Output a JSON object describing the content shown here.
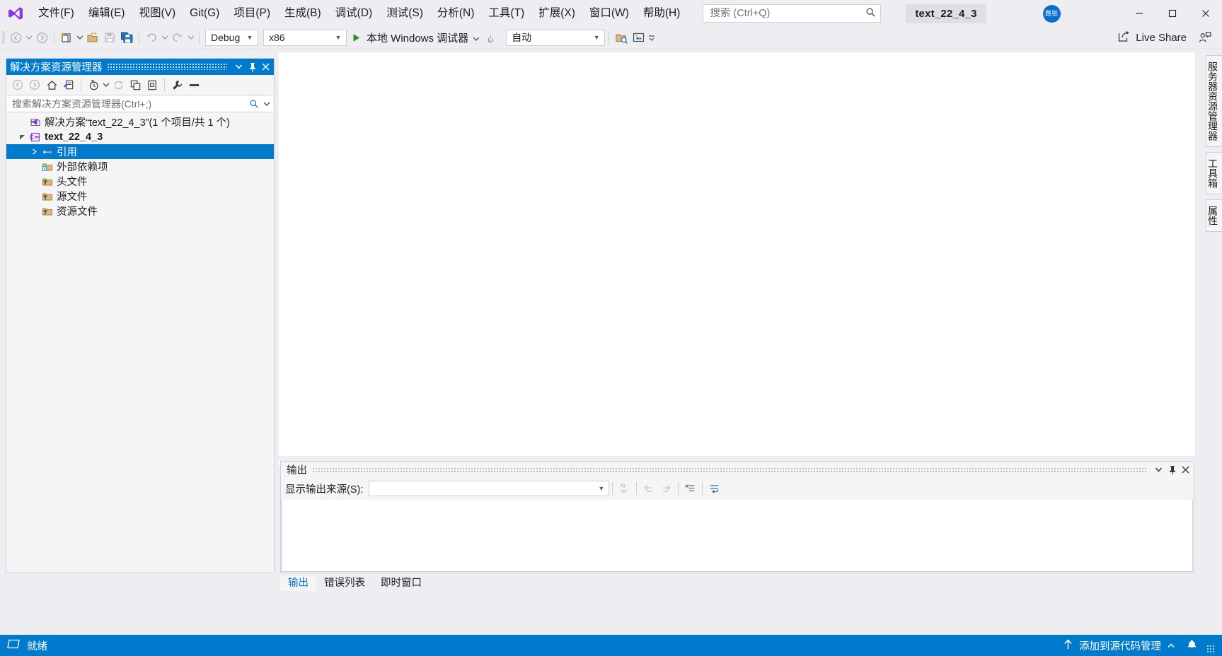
{
  "app": {
    "logo_icon": "visual-studio-logo",
    "document_title": "text_22_4_3",
    "account_initials": "路张"
  },
  "menu": {
    "items": [
      {
        "label": "文件(F)"
      },
      {
        "label": "编辑(E)"
      },
      {
        "label": "视图(V)"
      },
      {
        "label": "Git(G)"
      },
      {
        "label": "项目(P)"
      },
      {
        "label": "生成(B)"
      },
      {
        "label": "调试(D)"
      },
      {
        "label": "测试(S)"
      },
      {
        "label": "分析(N)"
      },
      {
        "label": "工具(T)"
      },
      {
        "label": "扩展(X)"
      },
      {
        "label": "窗口(W)"
      },
      {
        "label": "帮助(H)"
      }
    ]
  },
  "search": {
    "placeholder": "搜索 (Ctrl+Q)",
    "value": "",
    "icon": "search-icon"
  },
  "window_controls": {
    "minimize": "minimize-icon",
    "maximize": "maximize-icon",
    "close": "close-icon"
  },
  "toolbar": {
    "navigate_back": "navigate-back-icon",
    "navigate_forward": "navigate-forward-icon",
    "new_item": "new-item-icon",
    "open_file": "open-file-icon",
    "save": "save-icon",
    "save_all": "save-all-icon",
    "undo": "undo-icon",
    "redo": "redo-icon",
    "config": {
      "value": "Debug"
    },
    "platform": {
      "value": "x86"
    },
    "run_label": "本地 Windows 调试器",
    "hot_reload": "hot-reload-icon",
    "auto": {
      "value": "自动"
    },
    "select_window": "select-window-icon",
    "preview": "preview-icon",
    "live_share_label": "Live Share",
    "feedback": "feedback-icon"
  },
  "solution_explorer": {
    "title": "解决方案资源管理器",
    "header_color": "#007ACC",
    "window_menu_icon": "chevron-down-icon",
    "pin_icon": "pin-icon",
    "close_icon": "close-icon",
    "toolbar": {
      "back": "navigate-back-icon",
      "forward": "navigate-forward-icon",
      "home": "home-icon",
      "pending_changes": "pending-changes-icon",
      "history": "history-icon",
      "sync": "sync-icon",
      "collapse_all": "collapse-all-icon",
      "show_all_files": "show-all-files-icon",
      "properties": "properties-wrench-icon",
      "preview_selected": "preview-selected-icon"
    },
    "search": {
      "placeholder": "搜索解决方案资源管理器(Ctrl+;)",
      "value": "",
      "icon": "search-icon",
      "filter_icon": "chevron-down-icon"
    },
    "tree": [
      {
        "label": "解决方案“text_22_4_3”(1 个项目/共 1 个)",
        "icon": "solution-icon",
        "indent": 0,
        "expander": "none",
        "selected": false,
        "bold": false
      },
      {
        "label": "text_22_4_3",
        "icon": "cpp-project-icon",
        "indent": 1,
        "expander": "expanded",
        "selected": false,
        "bold": true
      },
      {
        "label": "引用",
        "icon": "references-icon",
        "indent": 2,
        "expander": "collapsed",
        "selected": true,
        "bold": false
      },
      {
        "label": "外部依赖项",
        "icon": "external-dependencies-icon",
        "indent": 2,
        "expander": "none",
        "selected": false,
        "bold": false
      },
      {
        "label": "头文件",
        "icon": "filter-folder-icon",
        "indent": 2,
        "expander": "none",
        "selected": false,
        "bold": false
      },
      {
        "label": "源文件",
        "icon": "filter-folder-icon",
        "indent": 2,
        "expander": "none",
        "selected": false,
        "bold": false
      },
      {
        "label": "资源文件",
        "icon": "filter-folder-icon",
        "indent": 2,
        "expander": "none",
        "selected": false,
        "bold": false
      }
    ]
  },
  "output_panel": {
    "title": "输出",
    "window_menu_icon": "chevron-down-icon",
    "pin_icon": "pin-icon",
    "close_icon": "close-icon",
    "source_label": "显示输出来源(S):",
    "source_value": "",
    "source_arrow_icon": "chevron-down-icon",
    "toolbar": {
      "find_message": "find-message-icon",
      "go_to_previous": "go-to-previous-message-icon",
      "go_to_next": "go-to-next-message-icon",
      "clear_all": "clear-all-icon",
      "toggle_word_wrap": "toggle-word-wrap-icon"
    },
    "body_text": ""
  },
  "bottom_tabs": [
    {
      "label": "输出",
      "active": true
    },
    {
      "label": "错误列表",
      "active": false
    },
    {
      "label": "即时窗口",
      "active": false
    }
  ],
  "right_tabs": [
    {
      "label": "服务器资源管理器"
    },
    {
      "label": "工具箱"
    },
    {
      "label": "属性"
    }
  ],
  "status_bar": {
    "background": "#007ACC",
    "ready_icon": "ready-icon",
    "ready_text": "就绪",
    "source_control_icon": "upload-arrow-icon",
    "source_control_text": "添加到源代码管理",
    "source_control_arrow_icon": "chevron-up-icon",
    "notification_icon": "bell-icon"
  }
}
